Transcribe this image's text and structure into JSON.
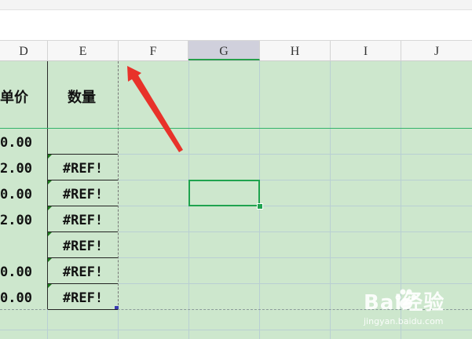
{
  "columns": [
    "D",
    "E",
    "F",
    "G",
    "H",
    "I",
    "J"
  ],
  "selected_column": "G",
  "header_row": {
    "d_label": "单价",
    "e_label": "数量"
  },
  "rows": [
    {
      "d": "0.00",
      "e": ""
    },
    {
      "d": "2.00",
      "e": "#REF!"
    },
    {
      "d": "0.00",
      "e": "#REF!"
    },
    {
      "d": "2.00",
      "e": "#REF!"
    },
    {
      "d": "",
      "e": "#REF!"
    },
    {
      "d": "0.00",
      "e": "#REF!"
    },
    {
      "d": "0.00",
      "e": "#REF!"
    }
  ],
  "colors": {
    "grid_bg": "#cde7cd",
    "selection": "#1fa34f",
    "arrow": "#e8322a"
  },
  "annotation": {
    "type": "red-arrow",
    "points_to": "column E/F boundary"
  },
  "watermark": {
    "brand": "Bai经验",
    "url": "jingyan.baidu.com"
  }
}
